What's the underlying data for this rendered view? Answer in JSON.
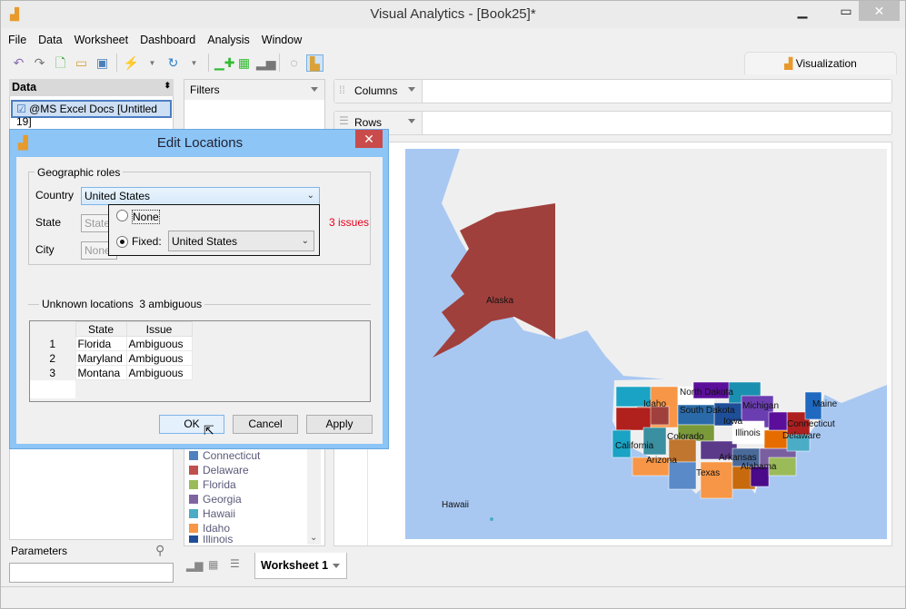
{
  "window": {
    "title": "Visual Analytics - [Book25]*",
    "minimize_icon": "minimize-icon",
    "maximize_icon": "maximize-icon",
    "close_icon": "close-icon"
  },
  "menu": [
    "File",
    "Data",
    "Worksheet",
    "Dashboard",
    "Analysis",
    "Window"
  ],
  "toolbar": {
    "icons": [
      "undo-icon",
      "redo-icon",
      "new-icon",
      "open-icon",
      "save-icon",
      "connect-icon",
      "refresh-icon",
      "new-worksheet-icon",
      "new-dashboard-icon",
      "bar-chart-icon",
      "lasso-icon",
      "show-me-icon"
    ]
  },
  "visualization_tab": "Visualization",
  "data_panel": {
    "title": "Data",
    "datasource": "@MS Excel Docs [Untitled 19]"
  },
  "filters": {
    "title": "Filters"
  },
  "legend": [
    {
      "label": "Connecticut",
      "color": "#4f81bd"
    },
    {
      "label": "Delaware",
      "color": "#c0504d"
    },
    {
      "label": "Florida",
      "color": "#9bbb59"
    },
    {
      "label": "Georgia",
      "color": "#8064a2"
    },
    {
      "label": "Hawaii",
      "color": "#4bacc6"
    },
    {
      "label": "Idaho",
      "color": "#f79646"
    },
    {
      "label": "Illinois",
      "color": "#1f4e99"
    }
  ],
  "shelves": {
    "columns": "Columns",
    "rows": "Rows"
  },
  "parameters": {
    "title": "Parameters"
  },
  "sheet_tab": "Worksheet 1",
  "map_labels": [
    "Alaska",
    "Hawaii",
    "Idaho",
    "North Dakota",
    "South Dakota",
    "Michigan",
    "Iowa",
    "Illinois",
    "Colorado",
    "California",
    "Arizona",
    "Arkansas",
    "Texas",
    "Alabama",
    "Maine",
    "Connecticut",
    "Delaware"
  ],
  "dialog": {
    "title": "Edit Locations",
    "geo_group": "Geographic roles",
    "country_label": "Country",
    "country_value": "United States",
    "state_label": "State",
    "state_value": "State",
    "city_label": "City",
    "city_value": "None",
    "issues": "3 issues",
    "popup": {
      "none_label": "None",
      "fixed_label": "Fixed:",
      "fixed_value": "United States",
      "selected": "fixed"
    },
    "unknown_title": "Unknown locations",
    "unknown_count": "3 ambiguous",
    "table": {
      "headers": [
        "State",
        "Issue"
      ],
      "rows": [
        [
          "1",
          "Florida",
          "Ambiguous"
        ],
        [
          "2",
          "Maryland",
          "Ambiguous"
        ],
        [
          "3",
          "Montana",
          "Ambiguous"
        ]
      ]
    },
    "ok": "OK",
    "cancel": "Cancel",
    "apply": "Apply"
  },
  "colors": {
    "accent": "#8cc5f6",
    "issues": "#e8001c",
    "alaska": "#a0403c",
    "ocean": "#a8c8f2"
  }
}
